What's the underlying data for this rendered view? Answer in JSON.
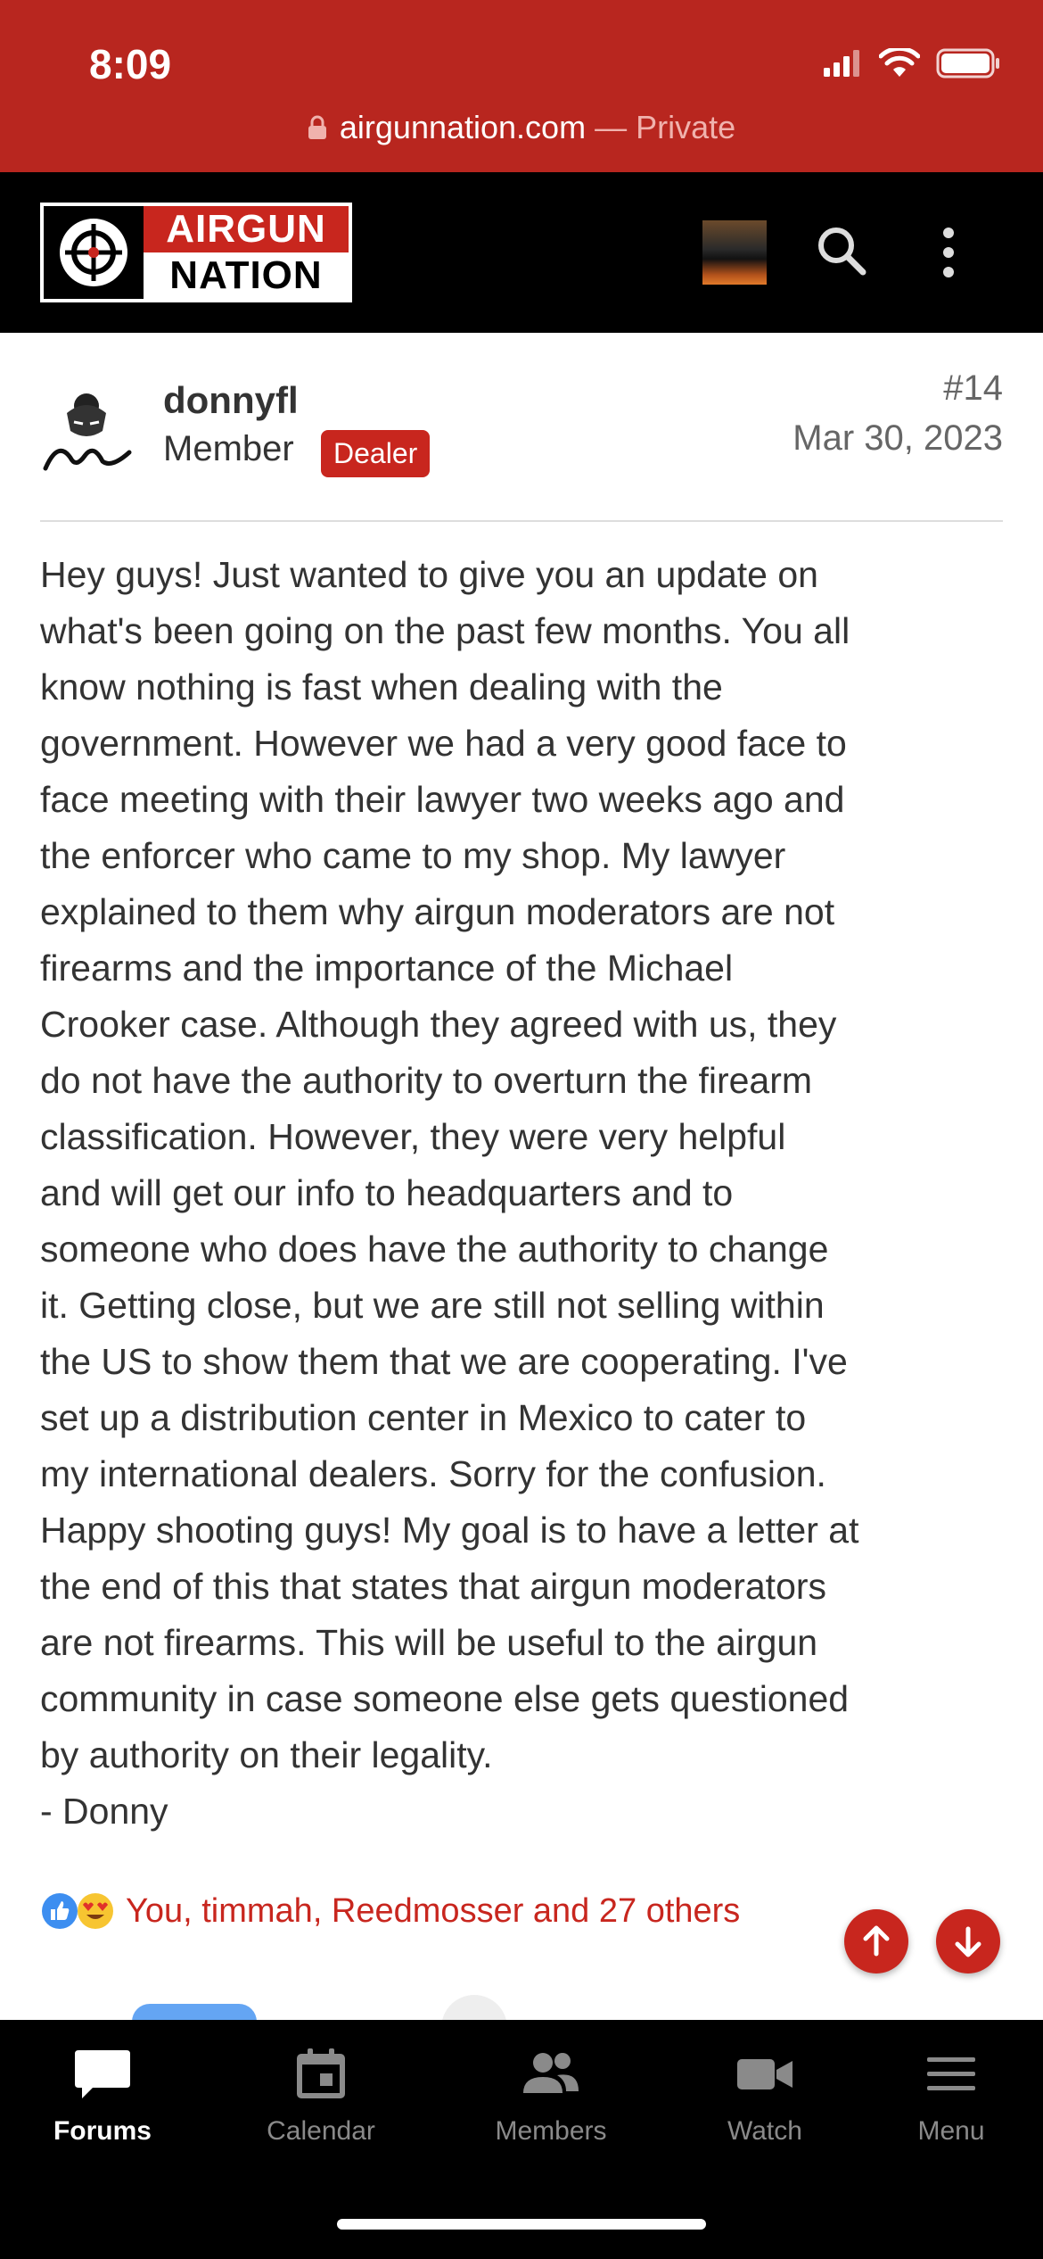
{
  "status_bar": {
    "time": "8:09"
  },
  "browser": {
    "domain": "airgunnation.com",
    "mode": " — Private"
  },
  "header": {
    "logo_line1": "AIRGUN",
    "logo_line2": "NATION"
  },
  "post": {
    "username": "donnyfl",
    "role": "Member",
    "badge": "Dealer",
    "number": "#14",
    "date": "Mar 30, 2023",
    "body": "Hey guys! Just wanted to give you an update on\nwhat's been going on the past few months. You all\nknow nothing is fast when dealing with the\ngovernment. However we had a very good face to\nface meeting with their lawyer two weeks ago and\nthe enforcer who came to my shop. My lawyer\nexplained to them why airgun moderators are not\nfirearms and the importance of the Michael\nCrooker case. Although they agreed with us, they\ndo not have the authority to overturn the firearm\nclassification. However, they were very helpful\nand will get our info to headquarters and to\nsomeone who does have the authority to change\nit. Getting close, but we are still not selling within\nthe US to show them that we are cooperating. I've\nset up a distribution center in Mexico to cater to\nmy international dealers. Sorry for the confusion.\nHappy shooting guys! My goal is to have a letter at\nthe end of this that states that airgun moderators\nare not firearms. This will be useful to the airgun\ncommunity in case someone else gets questioned\nby authority on their legality.\n- Donny",
    "reactions_text": "You, timmah, Reedmosser and 27 others"
  },
  "tabs": [
    {
      "label": "Forums",
      "icon": "chat-bubble-icon",
      "active": true
    },
    {
      "label": "Calendar",
      "icon": "calendar-icon",
      "active": false
    },
    {
      "label": "Members",
      "icon": "members-icon",
      "active": false
    },
    {
      "label": "Watch",
      "icon": "video-camera-icon",
      "active": false
    },
    {
      "label": "Menu",
      "icon": "hamburger-icon",
      "active": false
    }
  ],
  "colors": {
    "brand": "#c8261e",
    "status_bar": "#b8261f",
    "topbar": "#000000"
  }
}
